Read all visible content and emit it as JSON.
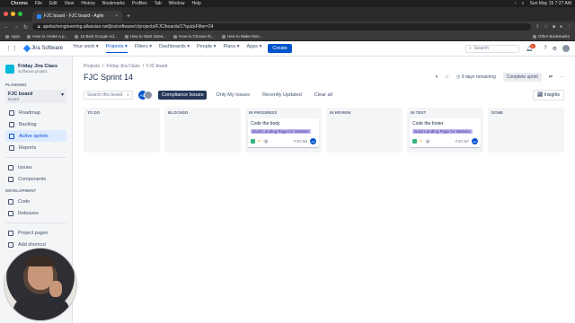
{
  "macbar": {
    "app": "Chrome",
    "menus": [
      "File",
      "Edit",
      "View",
      "History",
      "Bookmarks",
      "Profiles",
      "Tab",
      "Window",
      "Help"
    ],
    "datetime": "Sun May 15  7:27 AM"
  },
  "browser": {
    "tab_title": "FJC board - FJC board - Agile",
    "url": "apelachengineering.atlassian.net/jira/software/c/projects/FJC/boards/1?quickFilter=24",
    "bookmarks": [
      "Apps",
      "How to create a p...",
      "15 Best Google Ad...",
      "How to Start Strea...",
      "How to Choose th...",
      "How to Make Mon..."
    ],
    "other_bookmarks": "Other Bookmarks"
  },
  "jira_header": {
    "product": "Jira Software",
    "nav": [
      "Your work",
      "Projects",
      "Filters",
      "Dashboards",
      "People",
      "Plans",
      "Apps"
    ],
    "active_nav": "Projects",
    "create": "Create",
    "search_placeholder": "Search",
    "notif_count": "9+"
  },
  "sidebar": {
    "project_name": "Friday Jira Class",
    "project_type": "Software project",
    "planning_label": "PLANNING",
    "board_name": "FJC board",
    "board_type": "Board",
    "planning_items": [
      "Roadmap",
      "Backlog",
      "Active sprints",
      "Reports"
    ],
    "active_item": "Active sprints",
    "other_items": [
      "Issues",
      "Components"
    ],
    "development_label": "DEVELOPMENT",
    "dev_items": [
      "Code",
      "Releases"
    ],
    "bottom_items": [
      "Project pages",
      "Add shortcut"
    ]
  },
  "main": {
    "breadcrumbs": [
      "Projects",
      "/",
      "Friday Jira Class",
      "/",
      "FJC board"
    ],
    "title": "FJC Sprint 14",
    "days_remaining": "9 days remaining",
    "complete_sprint": "Complete sprint",
    "search_placeholder": "Search this board",
    "avatar_initials": "AO",
    "filters": [
      "Compliance Issues",
      "Only My Issues",
      "Recently Updated"
    ],
    "active_filter": "Compliance Issues",
    "clear_filters": "Clear all",
    "insights": "Insights"
  },
  "columns": [
    {
      "name": "TO DO",
      "cards": []
    },
    {
      "name": "BLOCKED",
      "cards": []
    },
    {
      "name": "IN PROGRESS",
      "cards": [
        {
          "title": "Code the body",
          "epic": "Build Landing Page for Website",
          "estimate": "3",
          "key": "FJC-56",
          "assignee": "AO"
        }
      ]
    },
    {
      "name": "IN REVIEW",
      "cards": []
    },
    {
      "name": "IN TEST",
      "cards": [
        {
          "title": "Code the footer",
          "epic": "Build Landing Page for Website",
          "estimate": "4",
          "key": "FJC-57",
          "assignee": "AO"
        }
      ]
    },
    {
      "name": "DONE",
      "cards": []
    }
  ],
  "colors": {
    "brand": "#0052cc",
    "epic_bg": "#c0b6f2",
    "story": "#36b37e"
  }
}
